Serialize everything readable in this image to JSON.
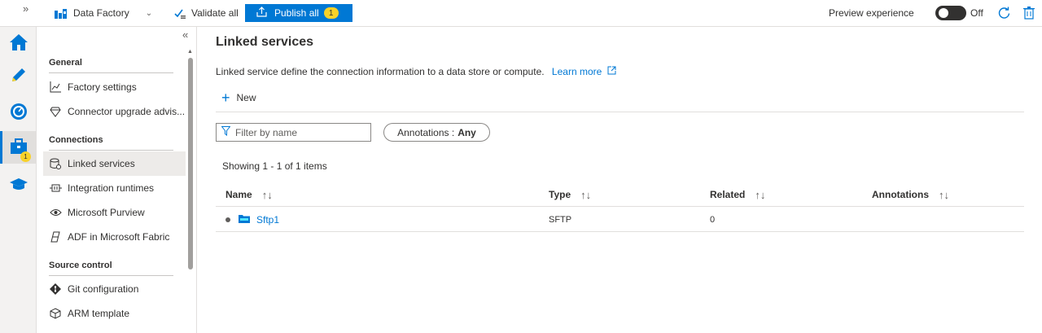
{
  "topbar": {
    "factory_label": "Data Factory",
    "validate_label": "Validate all",
    "publish_label": "Publish all",
    "publish_count": "1",
    "preview_label": "Preview experience",
    "toggle_state": "Off"
  },
  "rail": {
    "items": [
      {
        "name": "home",
        "icon": "home-icon"
      },
      {
        "name": "author",
        "icon": "pencil-icon"
      },
      {
        "name": "monitor",
        "icon": "gauge-icon"
      },
      {
        "name": "manage",
        "icon": "toolbox-icon",
        "badge": "1"
      },
      {
        "name": "learning",
        "icon": "graduation-cap-icon"
      }
    ]
  },
  "nav": {
    "sections": {
      "general": "General",
      "connections": "Connections",
      "source_control": "Source control"
    },
    "items": {
      "factory_settings": "Factory settings",
      "connector_upgrade": "Connector upgrade advis...",
      "linked_services": "Linked services",
      "integration_runtimes": "Integration runtimes",
      "purview": "Microsoft Purview",
      "adf_fabric": "ADF in Microsoft Fabric",
      "git_config": "Git configuration",
      "arm_template": "ARM template"
    }
  },
  "main": {
    "title": "Linked services",
    "description": "Linked service define the connection information to a data store or compute.",
    "learn_more": "Learn more",
    "new_label": "New",
    "filter_placeholder": "Filter by name",
    "annotations_label": "Annotations :",
    "annotations_value": "Any",
    "showing": "Showing 1 - 1 of 1 items",
    "columns": [
      "Name",
      "Type",
      "Related",
      "Annotations"
    ],
    "rows": [
      {
        "name": "Sftp1",
        "type": "SFTP",
        "related": "0",
        "annotations": ""
      }
    ]
  },
  "colors": {
    "accent": "#0078d4",
    "badge": "#f8d22a"
  }
}
